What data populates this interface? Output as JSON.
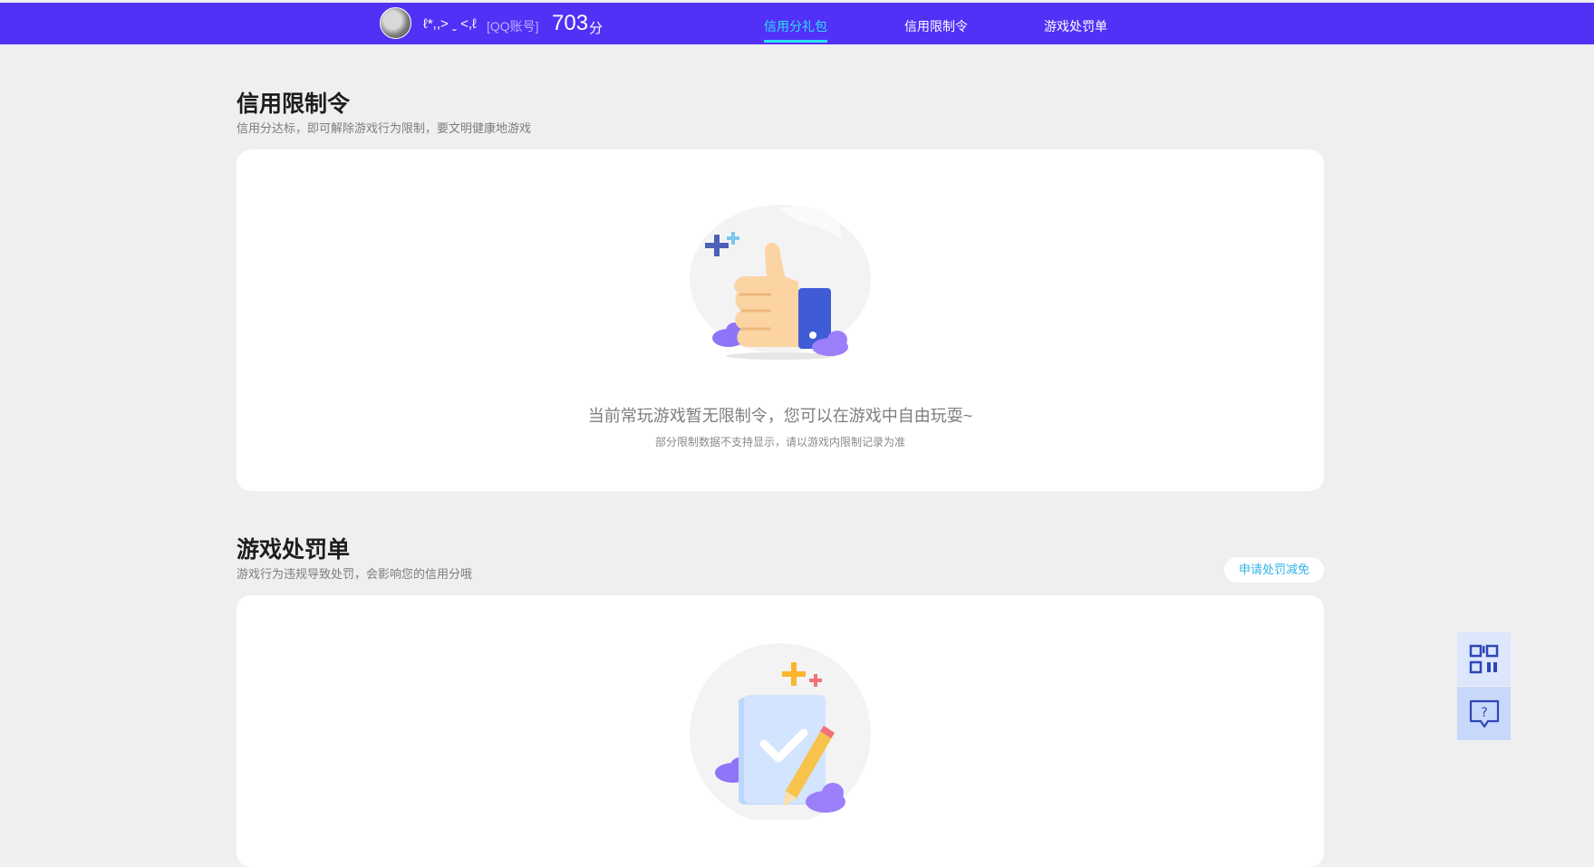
{
  "header": {
    "nickname": "ℓ*,,> ˬ <,ℓ",
    "account_type": "[QQ账号]",
    "score": "703",
    "score_unit": "分",
    "nav": [
      {
        "label": "信用分礼包",
        "active": true
      },
      {
        "label": "信用限制令",
        "active": false
      },
      {
        "label": "游戏处罚单",
        "active": false
      }
    ]
  },
  "restriction": {
    "title": "信用限制令",
    "subtitle": "信用分达标，即可解除游戏行为限制，要文明健康地游戏",
    "empty_message": "当前常玩游戏暂无限制令，您可以在游戏中自由玩耍~",
    "empty_note": "部分限制数据不支持显示，请以游戏内限制记录为准"
  },
  "punishment": {
    "title": "游戏处罚单",
    "subtitle": "游戏行为违规导致处罚，会影响您的信用分哦",
    "appeal_button": "申请处罚减免"
  },
  "float_tools": [
    {
      "icon": "qr-code-icon"
    },
    {
      "icon": "help-chat-icon"
    }
  ],
  "colors": {
    "brand": "#5230f6",
    "nav_active": "#29e2f5",
    "link": "#2fb5e8",
    "background": "#efefef"
  }
}
